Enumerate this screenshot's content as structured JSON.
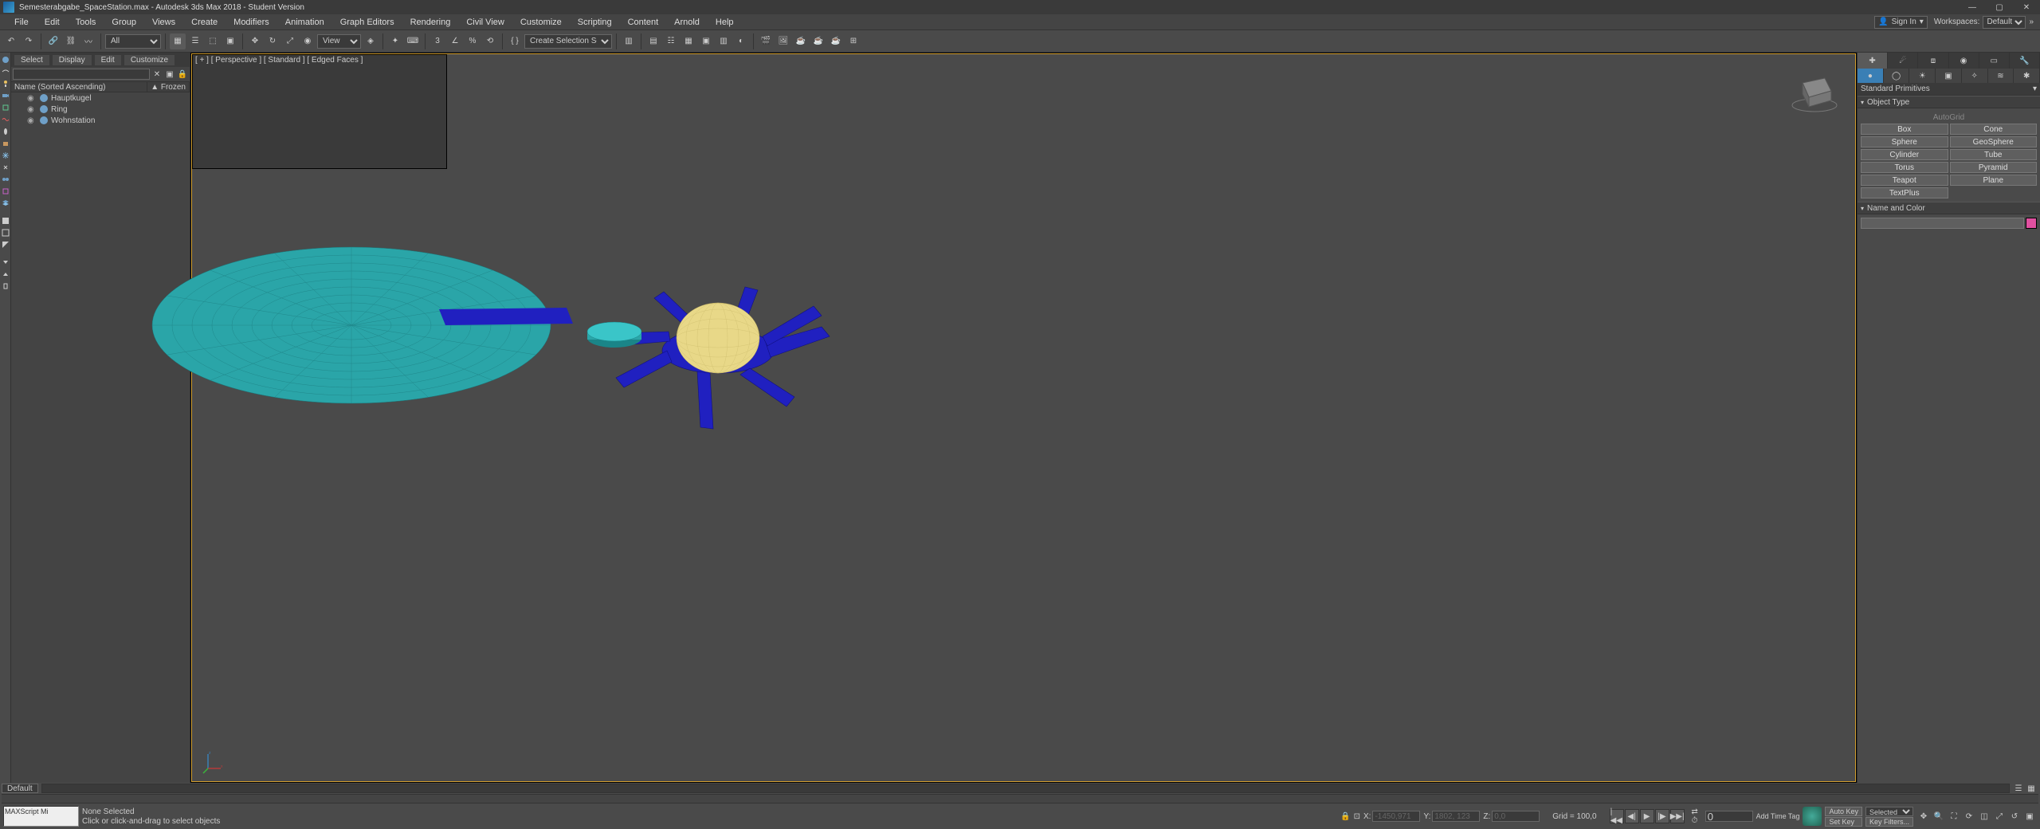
{
  "title": "Semesterabgabe_SpaceStation.max - Autodesk 3ds Max 2018 - Student Version",
  "menus": [
    "File",
    "Edit",
    "Tools",
    "Group",
    "Views",
    "Create",
    "Modifiers",
    "Animation",
    "Graph Editors",
    "Rendering",
    "Civil View",
    "Customize",
    "Scripting",
    "Content",
    "Arnold",
    "Help"
  ],
  "signin": "Sign In",
  "workspace_label": "Workspaces:",
  "workspace_value": "Default",
  "toolbar_filter": "All",
  "view_label": "View",
  "selection_set": "Create Selection Se",
  "scene_explorer": {
    "tabs": [
      "Select",
      "Display",
      "Edit",
      "Customize"
    ],
    "col_name": "Name (Sorted Ascending)",
    "col_frozen": "▲ Frozen",
    "items": [
      {
        "name": "Hauptkugel"
      },
      {
        "name": "Ring"
      },
      {
        "name": "Wohnstation"
      }
    ]
  },
  "viewport_label": "[ + ] [ Perspective ] [ Standard ] [ Edged Faces ]",
  "command_panel": {
    "dropdown": "Standard Primitives",
    "object_type_header": "Object Type",
    "autogrid": "AutoGrid",
    "primitives": [
      "Box",
      "Cone",
      "Sphere",
      "GeoSphere",
      "Cylinder",
      "Tube",
      "Torus",
      "Pyramid",
      "Teapot",
      "Plane",
      "TextPlus"
    ],
    "name_color_header": "Name and Color",
    "color": "#3a7fb5"
  },
  "timeline_default": "Default",
  "status": {
    "script": "MAXScript Mi",
    "selection": "None Selected",
    "prompt": "Click or click-and-drag to select objects",
    "x": "-1450,971",
    "y": "1802, 123",
    "z": "0,0",
    "grid": "Grid = 100,0",
    "frame": "0",
    "add_time_tag": "Add Time Tag",
    "autokey": "Auto Key",
    "setkey": "Set Key",
    "selected": "Selected",
    "keyfilters": "Key Filters..."
  }
}
